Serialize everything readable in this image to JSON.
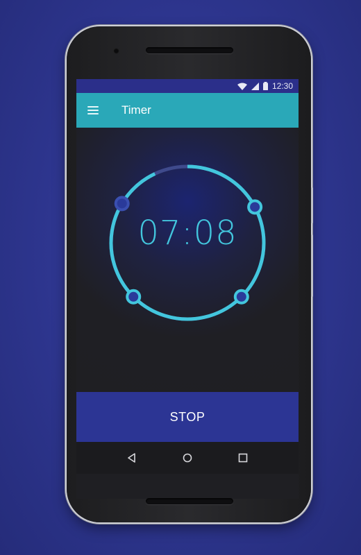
{
  "status": {
    "time": "12:30"
  },
  "toolbar": {
    "title": "Timer",
    "menu_icon": "hamburger-menu-icon"
  },
  "timer": {
    "display": "07:08",
    "progress_fraction": 0.93,
    "handle_count": 4
  },
  "actions": {
    "stop_label": "STOP"
  },
  "nav": {
    "back_icon": "back-triangle-icon",
    "home_icon": "home-circle-icon",
    "recents_icon": "recents-square-icon"
  },
  "colors": {
    "background": "#2f3792",
    "status_bar": "#2b2f8a",
    "toolbar": "#2aa8b8",
    "accent": "#43c6dd",
    "stop_button": "#2c3594",
    "handle_fill": "#2a3a9a"
  }
}
